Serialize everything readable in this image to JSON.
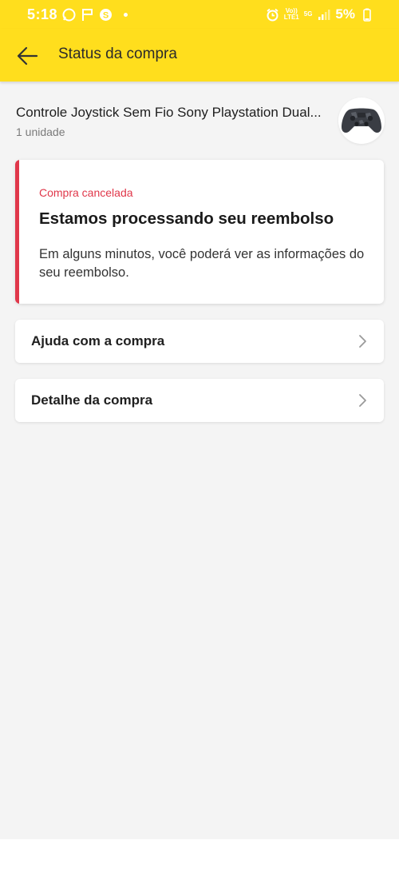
{
  "status_bar": {
    "time": "5:18",
    "network_top": "Vo))",
    "network_bottom": "LTE1",
    "signal_label": "5G",
    "battery": "5%"
  },
  "app_bar": {
    "title": "Status da compra",
    "back_icon": "arrow-left-icon"
  },
  "product": {
    "name": "Controle Joystick Sem Fio Sony Playstation Dual...",
    "quantity": "1 unidade",
    "thumbnail_icon": "gamepad-icon"
  },
  "status_card": {
    "tag": "Compra cancelada",
    "title": "Estamos processando seu reembolso",
    "description": "Em alguns minutos, você poderá ver as informações do seu reembolso.",
    "accent_color": "#e0374a"
  },
  "actions": [
    {
      "label": "Ajuda com a compra",
      "icon": "chevron-right-icon"
    },
    {
      "label": "Detalhe da compra",
      "icon": "chevron-right-icon"
    }
  ],
  "colors": {
    "brand_yellow": "#ffde1d",
    "background": "#f4f4f4",
    "danger": "#e0374a"
  }
}
